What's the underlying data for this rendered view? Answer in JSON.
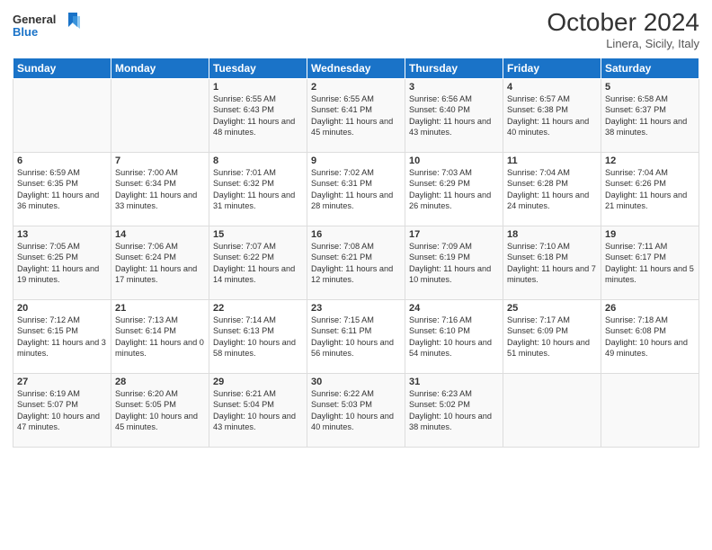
{
  "header": {
    "title": "October 2024",
    "subtitle": "Linera, Sicily, Italy"
  },
  "calendar": {
    "days": [
      "Sunday",
      "Monday",
      "Tuesday",
      "Wednesday",
      "Thursday",
      "Friday",
      "Saturday"
    ]
  },
  "weeks": [
    [
      {
        "num": "",
        "info": ""
      },
      {
        "num": "",
        "info": ""
      },
      {
        "num": "1",
        "info": "Sunrise: 6:55 AM\nSunset: 6:43 PM\nDaylight: 11 hours and 48 minutes."
      },
      {
        "num": "2",
        "info": "Sunrise: 6:55 AM\nSunset: 6:41 PM\nDaylight: 11 hours and 45 minutes."
      },
      {
        "num": "3",
        "info": "Sunrise: 6:56 AM\nSunset: 6:40 PM\nDaylight: 11 hours and 43 minutes."
      },
      {
        "num": "4",
        "info": "Sunrise: 6:57 AM\nSunset: 6:38 PM\nDaylight: 11 hours and 40 minutes."
      },
      {
        "num": "5",
        "info": "Sunrise: 6:58 AM\nSunset: 6:37 PM\nDaylight: 11 hours and 38 minutes."
      }
    ],
    [
      {
        "num": "6",
        "info": "Sunrise: 6:59 AM\nSunset: 6:35 PM\nDaylight: 11 hours and 36 minutes."
      },
      {
        "num": "7",
        "info": "Sunrise: 7:00 AM\nSunset: 6:34 PM\nDaylight: 11 hours and 33 minutes."
      },
      {
        "num": "8",
        "info": "Sunrise: 7:01 AM\nSunset: 6:32 PM\nDaylight: 11 hours and 31 minutes."
      },
      {
        "num": "9",
        "info": "Sunrise: 7:02 AM\nSunset: 6:31 PM\nDaylight: 11 hours and 28 minutes."
      },
      {
        "num": "10",
        "info": "Sunrise: 7:03 AM\nSunset: 6:29 PM\nDaylight: 11 hours and 26 minutes."
      },
      {
        "num": "11",
        "info": "Sunrise: 7:04 AM\nSunset: 6:28 PM\nDaylight: 11 hours and 24 minutes."
      },
      {
        "num": "12",
        "info": "Sunrise: 7:04 AM\nSunset: 6:26 PM\nDaylight: 11 hours and 21 minutes."
      }
    ],
    [
      {
        "num": "13",
        "info": "Sunrise: 7:05 AM\nSunset: 6:25 PM\nDaylight: 11 hours and 19 minutes."
      },
      {
        "num": "14",
        "info": "Sunrise: 7:06 AM\nSunset: 6:24 PM\nDaylight: 11 hours and 17 minutes."
      },
      {
        "num": "15",
        "info": "Sunrise: 7:07 AM\nSunset: 6:22 PM\nDaylight: 11 hours and 14 minutes."
      },
      {
        "num": "16",
        "info": "Sunrise: 7:08 AM\nSunset: 6:21 PM\nDaylight: 11 hours and 12 minutes."
      },
      {
        "num": "17",
        "info": "Sunrise: 7:09 AM\nSunset: 6:19 PM\nDaylight: 11 hours and 10 minutes."
      },
      {
        "num": "18",
        "info": "Sunrise: 7:10 AM\nSunset: 6:18 PM\nDaylight: 11 hours and 7 minutes."
      },
      {
        "num": "19",
        "info": "Sunrise: 7:11 AM\nSunset: 6:17 PM\nDaylight: 11 hours and 5 minutes."
      }
    ],
    [
      {
        "num": "20",
        "info": "Sunrise: 7:12 AM\nSunset: 6:15 PM\nDaylight: 11 hours and 3 minutes."
      },
      {
        "num": "21",
        "info": "Sunrise: 7:13 AM\nSunset: 6:14 PM\nDaylight: 11 hours and 0 minutes."
      },
      {
        "num": "22",
        "info": "Sunrise: 7:14 AM\nSunset: 6:13 PM\nDaylight: 10 hours and 58 minutes."
      },
      {
        "num": "23",
        "info": "Sunrise: 7:15 AM\nSunset: 6:11 PM\nDaylight: 10 hours and 56 minutes."
      },
      {
        "num": "24",
        "info": "Sunrise: 7:16 AM\nSunset: 6:10 PM\nDaylight: 10 hours and 54 minutes."
      },
      {
        "num": "25",
        "info": "Sunrise: 7:17 AM\nSunset: 6:09 PM\nDaylight: 10 hours and 51 minutes."
      },
      {
        "num": "26",
        "info": "Sunrise: 7:18 AM\nSunset: 6:08 PM\nDaylight: 10 hours and 49 minutes."
      }
    ],
    [
      {
        "num": "27",
        "info": "Sunrise: 6:19 AM\nSunset: 5:07 PM\nDaylight: 10 hours and 47 minutes."
      },
      {
        "num": "28",
        "info": "Sunrise: 6:20 AM\nSunset: 5:05 PM\nDaylight: 10 hours and 45 minutes."
      },
      {
        "num": "29",
        "info": "Sunrise: 6:21 AM\nSunset: 5:04 PM\nDaylight: 10 hours and 43 minutes."
      },
      {
        "num": "30",
        "info": "Sunrise: 6:22 AM\nSunset: 5:03 PM\nDaylight: 10 hours and 40 minutes."
      },
      {
        "num": "31",
        "info": "Sunrise: 6:23 AM\nSunset: 5:02 PM\nDaylight: 10 hours and 38 minutes."
      },
      {
        "num": "",
        "info": ""
      },
      {
        "num": "",
        "info": ""
      }
    ]
  ]
}
